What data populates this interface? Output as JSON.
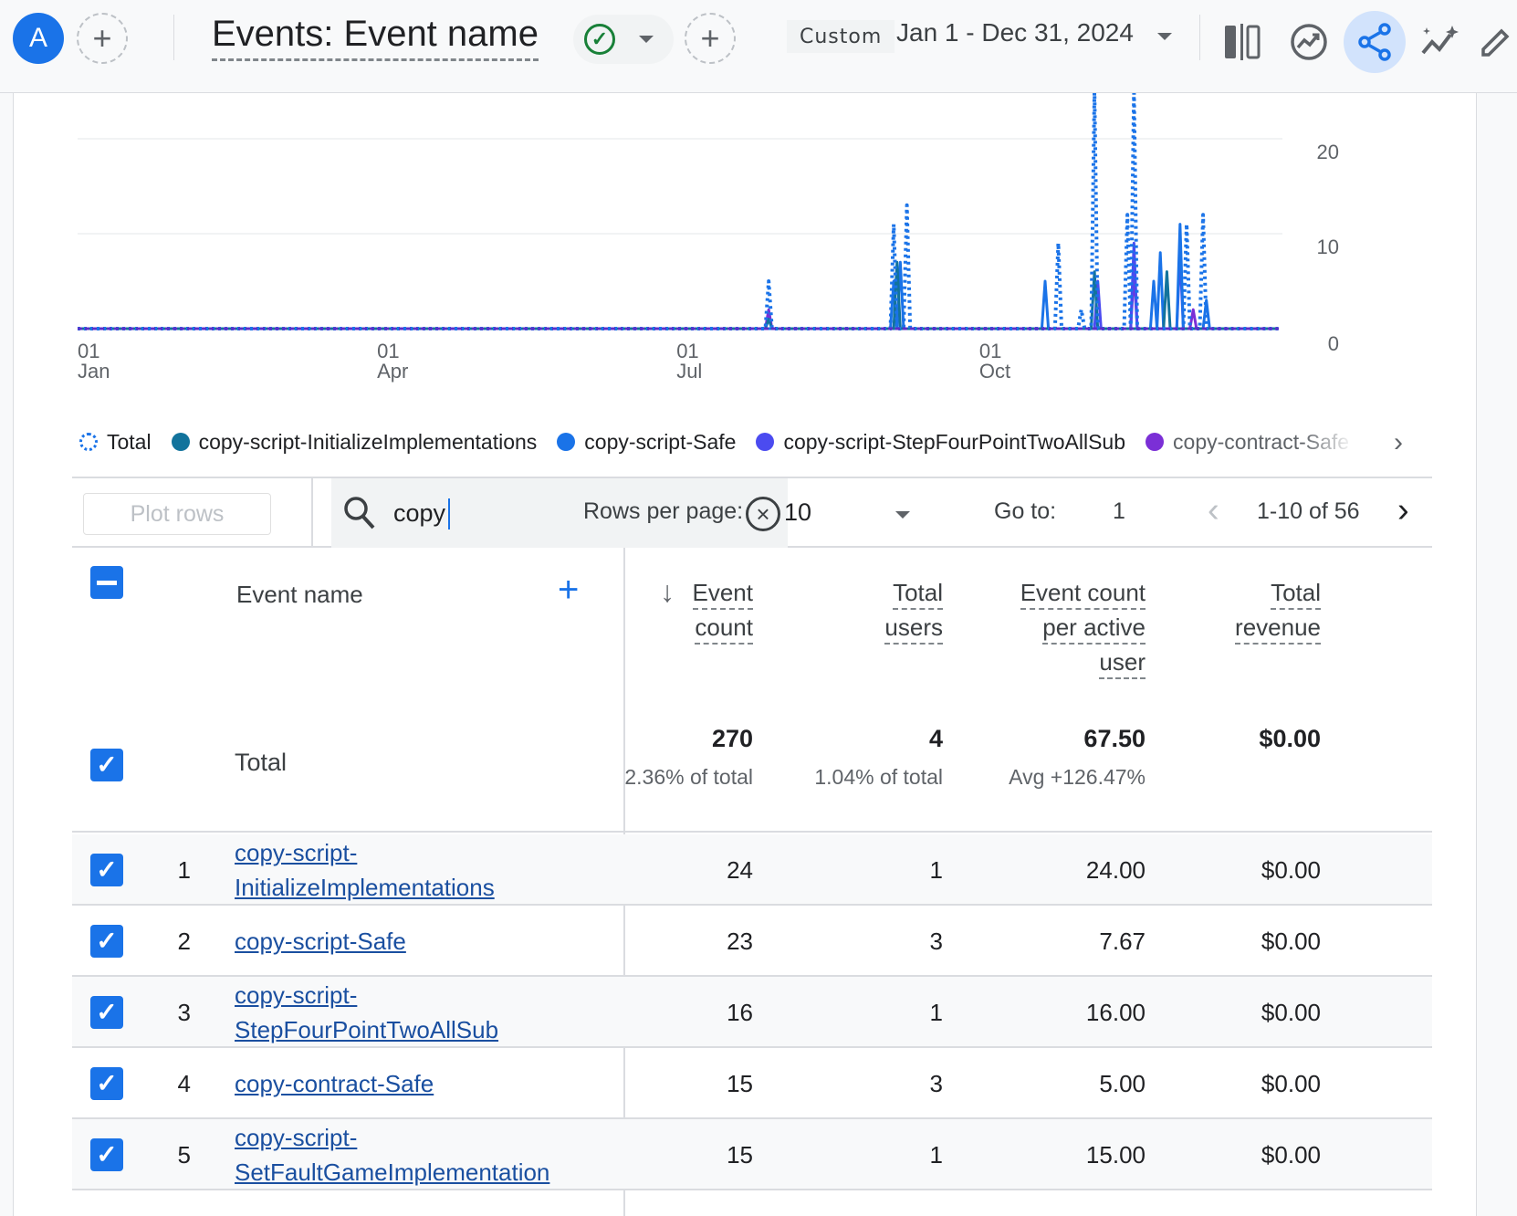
{
  "header": {
    "avatar_letter": "A",
    "title": "Events: Event name",
    "date_preset": "Custom",
    "date_range": "Jan 1 - Dec 31, 2024",
    "icons": [
      "compare-icon",
      "insights-icon",
      "share-icon",
      "anomaly-icon",
      "edit-icon"
    ]
  },
  "chart_data": {
    "type": "line",
    "title": "",
    "xlabel": "",
    "ylabel": "",
    "x_ticks": [
      {
        "day": "01",
        "month": "Jan"
      },
      {
        "day": "01",
        "month": "Apr"
      },
      {
        "day": "01",
        "month": "Jul"
      },
      {
        "day": "01",
        "month": "Oct"
      }
    ],
    "y_ticks": [
      0,
      10,
      20
    ],
    "ylim": [
      0,
      24
    ],
    "xlim": [
      "2024-01-01",
      "2024-12-31"
    ],
    "grid": true,
    "legend_position": "bottom",
    "series": [
      {
        "name": "Total",
        "color": "#1a73e8",
        "style": "dotted",
        "points": [
          [
            "2024-07-29",
            5
          ],
          [
            "2024-09-05",
            11
          ],
          [
            "2024-09-09",
            13
          ],
          [
            "2024-10-25",
            9
          ],
          [
            "2024-11-01",
            2
          ],
          [
            "2024-11-05",
            30
          ],
          [
            "2024-11-15",
            12
          ],
          [
            "2024-11-17",
            30
          ],
          [
            "2024-12-03",
            11
          ],
          [
            "2024-12-08",
            12
          ]
        ]
      },
      {
        "name": "copy-script-InitializeImplementations",
        "color": "#12739c",
        "style": "solid",
        "points": [
          [
            "2024-07-29",
            1
          ],
          [
            "2024-09-06",
            7
          ],
          [
            "2024-11-05",
            6
          ],
          [
            "2024-11-27",
            6
          ]
        ]
      },
      {
        "name": "copy-script-Safe",
        "color": "#1a73e8",
        "style": "solid",
        "points": [
          [
            "2024-09-05",
            5
          ],
          [
            "2024-09-07",
            7
          ],
          [
            "2024-10-21",
            5
          ],
          [
            "2024-11-23",
            5
          ],
          [
            "2024-11-25",
            8
          ],
          [
            "2024-12-01",
            11
          ],
          [
            "2024-12-09",
            3
          ]
        ]
      },
      {
        "name": "copy-script-StepFourPointTwoAllSub",
        "color": "#4b4bf0",
        "style": "solid",
        "points": [
          [
            "2024-11-06",
            5
          ],
          [
            "2024-11-17",
            9
          ],
          [
            "2024-12-01",
            8
          ]
        ]
      },
      {
        "name": "copy-contract-Safe",
        "color": "#7b2fd6",
        "style": "solid",
        "points": [
          [
            "2024-07-29",
            2
          ],
          [
            "2024-11-17",
            6
          ],
          [
            "2024-12-05",
            2
          ]
        ]
      }
    ]
  },
  "legend": {
    "items": [
      {
        "label": "Total",
        "color": "#1a73e8",
        "dotted": true
      },
      {
        "label": "copy-script-InitializeImplementations",
        "color": "#12739c"
      },
      {
        "label": "copy-script-Safe",
        "color": "#1a73e8"
      },
      {
        "label": "copy-script-StepFourPointTwoAllSub",
        "color": "#4b4bf0"
      },
      {
        "label": "copy-contract-Safe",
        "color": "#7b2fd6"
      }
    ]
  },
  "toolbar": {
    "plot_rows": "Plot rows",
    "search_value": "copy",
    "rows_per_page_label": "Rows per page:",
    "rows_per_page_value": "10",
    "goto_label": "Go to:",
    "goto_value": "1",
    "page_range": "1-10 of 56"
  },
  "table": {
    "dimension_header": "Event name",
    "metric_headers": [
      [
        "Event",
        "count"
      ],
      [
        "Total",
        "users"
      ],
      [
        "Event count",
        "per active",
        "user"
      ],
      [
        "Total",
        "revenue"
      ]
    ],
    "total": {
      "label": "Total",
      "values": [
        "270",
        "4",
        "67.50",
        "$0.00"
      ],
      "subs": [
        "2.36% of total",
        "1.04% of total",
        "Avg +126.47%",
        ""
      ]
    },
    "rows": [
      {
        "rank": "1",
        "name_lines": [
          "copy-script-",
          "InitializeImplementations"
        ],
        "values": [
          "24",
          "1",
          "24.00",
          "$0.00"
        ]
      },
      {
        "rank": "2",
        "name_lines": [
          "copy-script-Safe"
        ],
        "values": [
          "23",
          "3",
          "7.67",
          "$0.00"
        ]
      },
      {
        "rank": "3",
        "name_lines": [
          "copy-script-",
          "StepFourPointTwoAllSub"
        ],
        "values": [
          "16",
          "1",
          "16.00",
          "$0.00"
        ]
      },
      {
        "rank": "4",
        "name_lines": [
          "copy-contract-Safe"
        ],
        "values": [
          "15",
          "3",
          "5.00",
          "$0.00"
        ]
      },
      {
        "rank": "5",
        "name_lines": [
          "copy-script-",
          "SetFaultGameImplementation"
        ],
        "values": [
          "15",
          "1",
          "15.00",
          "$0.00"
        ]
      }
    ]
  }
}
